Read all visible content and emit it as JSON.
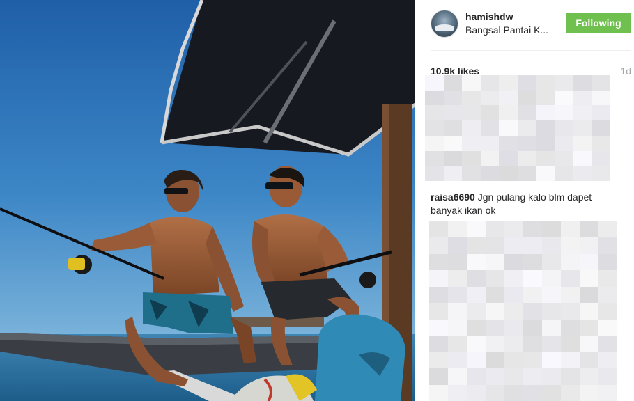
{
  "post": {
    "username": "hamishdw",
    "location": "Bangsal Pantai K...",
    "follow_label": "Following",
    "likes": "10.9k likes",
    "age": "1d"
  },
  "comments": [
    {
      "user": "raisa6690",
      "text": "Jgn pulang kalo blm dapet banyak ikan ok"
    }
  ],
  "colors": {
    "follow_button": "#70c050",
    "text": "#262626",
    "muted": "#a5a7aa"
  }
}
